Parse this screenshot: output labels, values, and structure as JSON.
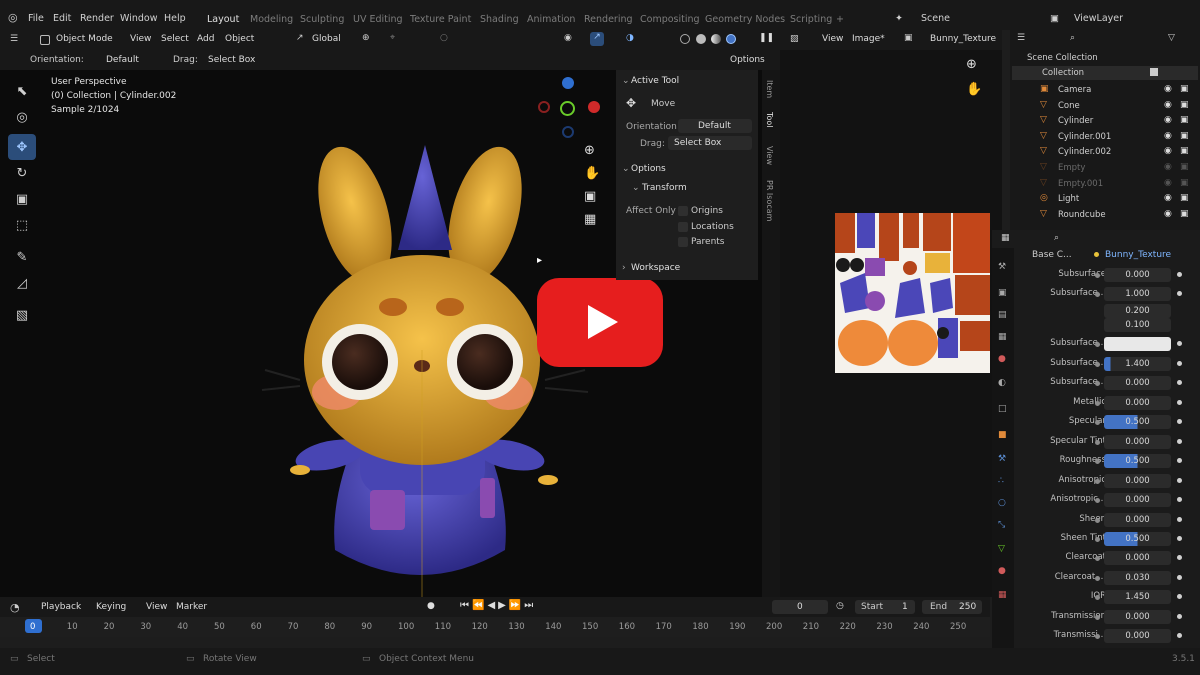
{
  "top_menu": [
    "File",
    "Edit",
    "Render",
    "Window",
    "Help"
  ],
  "workspaces": [
    "Layout",
    "Modeling",
    "Sculpting",
    "UV Editing",
    "Texture Paint",
    "Shading",
    "Animation",
    "Rendering",
    "Compositing",
    "Geometry Nodes",
    "Scripting"
  ],
  "scene": "Scene",
  "view_layer": "ViewLayer",
  "viewport_header": {
    "mode": "Object Mode",
    "menus": [
      "View",
      "Select",
      "Add",
      "Object"
    ],
    "transform": "Global"
  },
  "tool_settings": {
    "orientation_label": "Orientation:",
    "orientation_value": "Default",
    "drag_label": "Drag:",
    "drag_value": "Select Box",
    "options": "Options"
  },
  "viewport_overlay": {
    "perspective": "User Perspective",
    "collection": "(0) Collection | Cylinder.002",
    "sample": "Sample 2/1024"
  },
  "n_panel": {
    "active_tool": "Active Tool",
    "tool_name": "Move",
    "orientation_label": "Orientation",
    "orientation_value": "Default",
    "drag_label": "Drag:",
    "drag_value": "Select Box",
    "options": "Options",
    "transform": "Transform",
    "affect_only": "Affect Only",
    "affect_items": [
      "Origins",
      "Locations",
      "Parents"
    ],
    "workspace": "Workspace",
    "tabs": [
      "Item",
      "Tool",
      "View",
      "PR Isocam"
    ]
  },
  "image_editor": {
    "menus": [
      "View",
      "Image*"
    ],
    "image_name": "Bunny_Texture"
  },
  "outliner": {
    "root": "Scene Collection",
    "collection": "Collection",
    "items": [
      {
        "name": "Camera",
        "dim": false
      },
      {
        "name": "Cone",
        "dim": false
      },
      {
        "name": "Cylinder",
        "dim": false
      },
      {
        "name": "Cylinder.001",
        "dim": false
      },
      {
        "name": "Cylinder.002",
        "dim": false
      },
      {
        "name": "Empty",
        "dim": true
      },
      {
        "name": "Empty.001",
        "dim": true
      },
      {
        "name": "Light",
        "dim": false
      },
      {
        "name": "Roundcube",
        "dim": false
      }
    ]
  },
  "properties": {
    "base_color_label": "Base C...",
    "base_color_value": "Bunny_Texture",
    "rows": [
      {
        "label": "Subsurface",
        "value": "0.000",
        "style": "plain"
      },
      {
        "label": "Subsurface...",
        "value": "1.000",
        "style": "plain"
      },
      {
        "label": "",
        "value": "0.200",
        "style": "plain"
      },
      {
        "label": "",
        "value": "0.100",
        "style": "plain"
      },
      {
        "label": "Subsurface...",
        "value": "",
        "style": "white"
      },
      {
        "label": "Subsurface...",
        "value": "1.400",
        "style": "blue-sm"
      },
      {
        "label": "Subsurface...",
        "value": "0.000",
        "style": "plain"
      },
      {
        "label": "Metallic",
        "value": "0.000",
        "style": "plain"
      },
      {
        "label": "Specular",
        "value": "0.500",
        "style": "blue"
      },
      {
        "label": "Specular Tint",
        "value": "0.000",
        "style": "plain"
      },
      {
        "label": "Roughness",
        "value": "0.500",
        "style": "blue"
      },
      {
        "label": "Anisotropic",
        "value": "0.000",
        "style": "plain"
      },
      {
        "label": "Anisotropic...",
        "value": "0.000",
        "style": "plain"
      },
      {
        "label": "Sheen",
        "value": "0.000",
        "style": "plain"
      },
      {
        "label": "Sheen Tint",
        "value": "0.500",
        "style": "blue"
      },
      {
        "label": "Clearcoat",
        "value": "0.000",
        "style": "plain"
      },
      {
        "label": "Clearcoat ...",
        "value": "0.030",
        "style": "plain"
      },
      {
        "label": "IOR",
        "value": "1.450",
        "style": "plain"
      },
      {
        "label": "Transmission",
        "value": "0.000",
        "style": "plain"
      },
      {
        "label": "Transmissi...",
        "value": "0.000",
        "style": "plain"
      }
    ]
  },
  "timeline": {
    "menus": [
      "Playback",
      "Keying",
      "View",
      "Marker"
    ],
    "current_frame": "0",
    "start_label": "Start",
    "start": "1",
    "end_label": "End",
    "end": "250",
    "ticks": [
      "0",
      "10",
      "20",
      "30",
      "40",
      "50",
      "60",
      "70",
      "80",
      "90",
      "100",
      "110",
      "120",
      "130",
      "140",
      "150",
      "160",
      "170",
      "180",
      "190",
      "200",
      "210",
      "220",
      "230",
      "240",
      "250"
    ]
  },
  "status_bar": {
    "select": "Select",
    "rotate": "Rotate View",
    "context": "Object Context Menu",
    "version": "3.5.1"
  },
  "colors": {
    "accent": "#4373c4",
    "play_button": "#e61e1e",
    "bunny": "#e8b23a",
    "coat": "#4b47b8"
  }
}
